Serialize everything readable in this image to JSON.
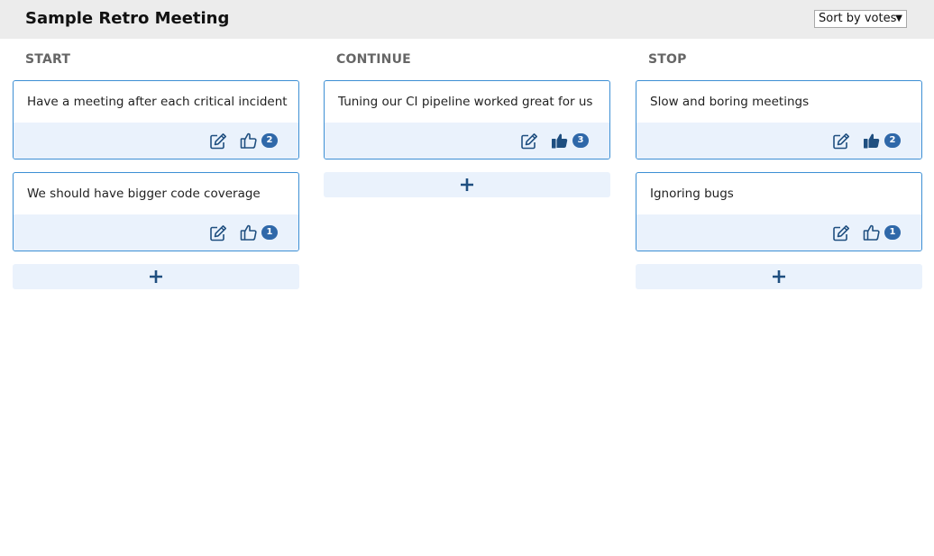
{
  "header": {
    "title": "Sample Retro Meeting",
    "sort": {
      "selected": "Sort by votes"
    }
  },
  "colors": {
    "accent": "#3d8fd4",
    "badge": "#2f68a9",
    "icon": "#1f4f80",
    "card_footer_bg": "#eaf2fc",
    "header_bg": "#ececec"
  },
  "columns": [
    {
      "title": "START",
      "cards": [
        {
          "text": "Have a meeting after each critical incident",
          "votes": "2",
          "voted": false
        },
        {
          "text": "We should have bigger code coverage",
          "votes": "1",
          "voted": false
        }
      ],
      "add_icon": "plus-icon"
    },
    {
      "title": "CONTINUE",
      "cards": [
        {
          "text": "Tuning our CI pipeline worked great for us",
          "votes": "3",
          "voted": true
        }
      ],
      "add_icon": "plus-icon"
    },
    {
      "title": "STOP",
      "cards": [
        {
          "text": "Slow and boring meetings",
          "votes": "2",
          "voted": true
        },
        {
          "text": "Ignoring bugs",
          "votes": "1",
          "voted": false
        }
      ],
      "add_icon": "plus-icon"
    }
  ],
  "icons": {
    "edit": "edit-icon",
    "vote_outline": "thumbs-up-outline-icon",
    "vote_filled": "thumbs-up-filled-icon",
    "add": "plus-icon",
    "sort_caret": "caret-down-icon"
  }
}
